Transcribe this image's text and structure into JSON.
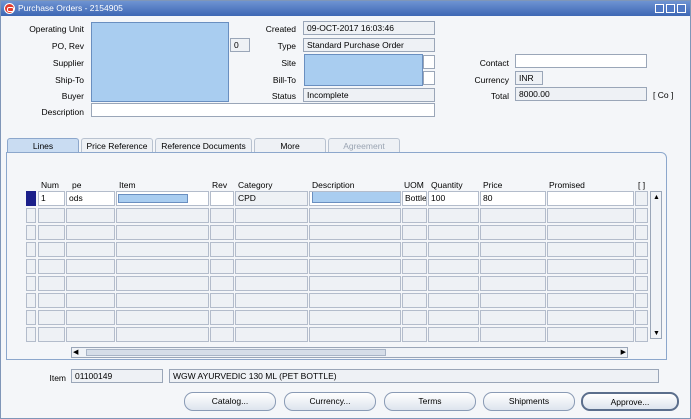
{
  "window": {
    "title": "Purchase Orders - 2154905",
    "title_icon": "oracle-icon",
    "controls": [
      "minimize-icon",
      "maximize-icon",
      "close-icon"
    ]
  },
  "header": {
    "operating_unit_label": "Operating Unit",
    "po_rev_label": "PO, Rev",
    "revision": "0",
    "supplier_label": "Supplier",
    "ship_to_label": "Ship-To",
    "buyer_label": "Buyer",
    "description_label": "Description",
    "created_label": "Created",
    "created_value": "09-OCT-2017 16:03:46",
    "type_label": "Type",
    "type_value": "Standard Purchase Order",
    "site_label": "Site",
    "bill_to_label": "Bill-To",
    "status_label": "Status",
    "status_value": "Incomplete",
    "contact_label": "Contact",
    "currency_label": "Currency",
    "currency_value": "INR",
    "total_label": "Total",
    "total_value": "8000.00",
    "total_flag": "[ Co ]"
  },
  "tabs": [
    {
      "label": "Lines",
      "state": "active"
    },
    {
      "label": "Price Reference",
      "state": "normal"
    },
    {
      "label": "Reference Documents",
      "state": "normal"
    },
    {
      "label": "More",
      "state": "normal"
    },
    {
      "label": "Agreement",
      "state": "disabled"
    }
  ],
  "lines": {
    "columns": [
      "Num",
      "pe",
      "Item",
      "Rev",
      "Category",
      "Description",
      "UOM",
      "Quantity",
      "Price",
      "Promised",
      "[ ]"
    ],
    "rows": [
      {
        "num": "1",
        "type": "ods",
        "item": "",
        "rev": "",
        "category": "CPD",
        "description": "",
        "uom": "Bottle",
        "quantity": "100",
        "price": "80",
        "promised": ""
      }
    ]
  },
  "footer": {
    "item_label": "Item",
    "item_code": "01100149",
    "item_description": "WGW AYURVEDIC 130 ML (PET BOTTLE)"
  },
  "buttons": {
    "catalog": "Catalog...",
    "currency": "Currency...",
    "terms": "Terms",
    "shipments": "Shipments",
    "approve": "Approve..."
  }
}
